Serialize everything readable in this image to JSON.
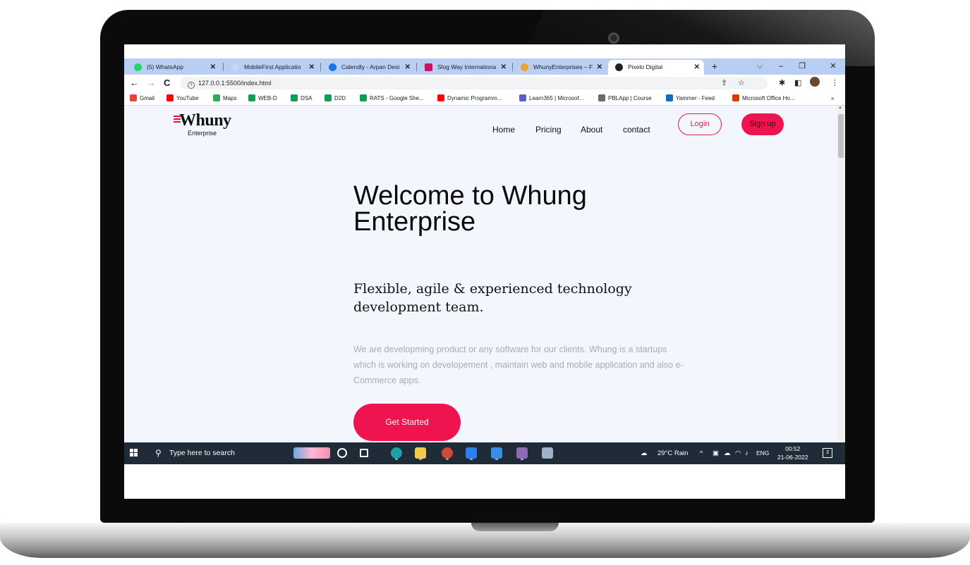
{
  "browser": {
    "tabs": [
      {
        "label": "(5) WhatsApp",
        "favicon_color": "#25d366",
        "active": false
      },
      {
        "label": "MobileFirst Applicatio",
        "favicon_color": "#c7d8f5",
        "active": false
      },
      {
        "label": "Calendly - Arpan Desi",
        "favicon_color": "#1a73e8",
        "active": false
      },
      {
        "label": "Slog Way Internationa",
        "favicon_color": "#c2185b",
        "active": false
      },
      {
        "label": "WhunyEnterprises – F",
        "favicon_color": "#e8a33d",
        "active": false
      },
      {
        "label": "Pixelo Digital",
        "favicon_color": "#202124",
        "active": true
      }
    ],
    "new_tab_label": "+",
    "address": "127.0.0.1:5500/index.html",
    "bookmarks": [
      {
        "label": "Gmail",
        "color": "#ea4335"
      },
      {
        "label": "YouTube",
        "color": "#ff0000"
      },
      {
        "label": "Maps",
        "color": "#34a853"
      },
      {
        "label": "WEB-D",
        "color": "#0f9d58"
      },
      {
        "label": "DSA",
        "color": "#0f9d58"
      },
      {
        "label": "D2D",
        "color": "#0f9d58"
      },
      {
        "label": "RATS - Google She...",
        "color": "#0f9d58"
      },
      {
        "label": "Dynamic Programm...",
        "color": "#ff0000"
      },
      {
        "label": "Learn365 | Microsof...",
        "color": "#5b5fc7"
      },
      {
        "label": "PBLApp | Course",
        "color": "#6a6a6a"
      },
      {
        "label": "Yammer - Feed",
        "color": "#106ebe"
      },
      {
        "label": "Microsoft Office Ho...",
        "color": "#d83b01"
      }
    ],
    "bookmarks_more": "»"
  },
  "site": {
    "logo_text": "Whuny",
    "logo_sub": "Enterprise",
    "nav": [
      "Home",
      "Pricing",
      "About",
      "contact"
    ],
    "login_label": "Login",
    "signup_label": "Sign up",
    "hero_title": "Welcome to Whung Enterprise",
    "hero_subtitle": "Flexible, agile & experienced technology development team.",
    "hero_description": "We are developming product or any software for our clients. Whung is a startups which is working on developement , maintain web and mobile application and also e-Commerce apps.",
    "cta_label": "Get Started",
    "accent_color": "#ef1450"
  },
  "taskbar": {
    "search_placeholder": "Type here to search",
    "weather": "29°C  Rain",
    "language": "ENG",
    "time": "00:52",
    "date": "21-06-2022",
    "notification_count": "3"
  }
}
